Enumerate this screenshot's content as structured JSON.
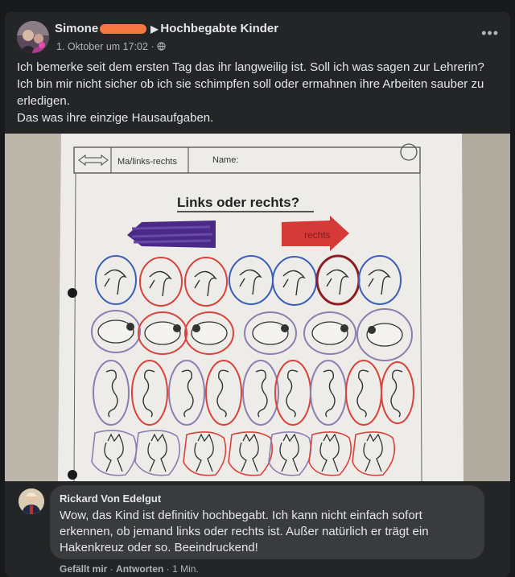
{
  "post": {
    "author": "Simone",
    "group": "Hochbegabte Kinder",
    "timestamp": "1. Oktober um 17:02",
    "separator": "·",
    "privacy_icon": "globe-icon",
    "more_label": "•••",
    "text_lines": [
      "Ich bemerke seit dem ersten Tag das ihr langweilig ist. Soll ich was sagen zur Lehrerin?",
      "Ich bin mir nicht sicher ob ich sie schimpfen soll oder ermahnen ihre Arbeiten sauber zu erledigen.",
      "Das was ihre einzige Hausaufgaben."
    ]
  },
  "worksheet": {
    "subject": "Ma/links-rechts",
    "name_label": "Name:",
    "title": "Links oder rechts?",
    "arrow_label": "rechts"
  },
  "comment": {
    "author": "Rickard Von Edelgut",
    "text": "Wow, das Kind ist definitiv hochbegabt. Ich kann nicht einfach sofort erkennen, ob jemand links oder rechts ist. Außer natürlich er trägt ein Hakenkreuz oder so. Beeindruckend!",
    "like_label": "Gefällt mir",
    "reply_label": "Antworten",
    "sep": "·",
    "time": "1 Min."
  },
  "colors": {
    "background": "#18191a",
    "card": "#242526",
    "bubble": "#3a3b3c",
    "text": "#e4e6eb",
    "muted": "#b0b3b8",
    "redaction": "#ff7a45"
  }
}
